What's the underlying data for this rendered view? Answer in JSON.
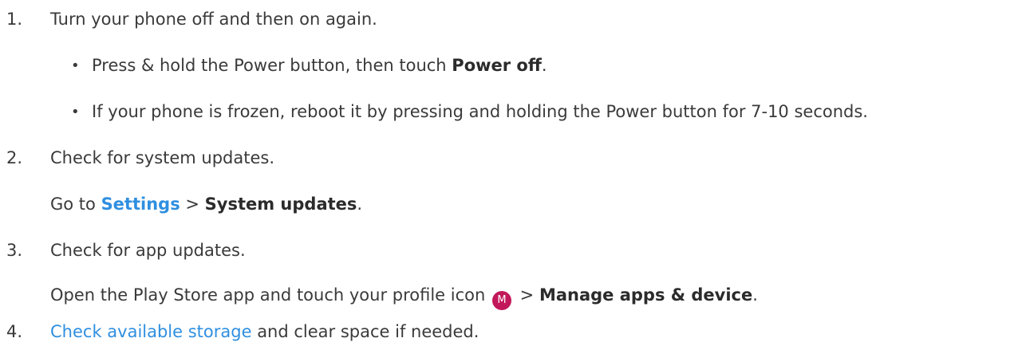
{
  "steps": [
    {
      "number": "1.",
      "text": "Turn your phone off and then on again.",
      "bullets": [
        {
          "prefix": "Press & hold the Power button, then touch ",
          "bold": "Power off",
          "suffix": "."
        },
        {
          "text": "If your phone is frozen, reboot it by pressing and holding the Power button for 7-10 seconds."
        }
      ]
    },
    {
      "number": "2.",
      "text": "Check for system updates.",
      "detail": {
        "prefix": "Go to ",
        "link": "Settings",
        "sep": " > ",
        "bold": "System updates",
        "suffix": "."
      }
    },
    {
      "number": "3.",
      "text": "Check for app updates.",
      "detail": {
        "prefix": "Open the Play Store app and touch your profile icon ",
        "avatar_letter": "M",
        "sep": " > ",
        "bold": "Manage apps & device",
        "suffix": "."
      }
    },
    {
      "number": "4.",
      "link": "Check available storage",
      "text": " and clear space if needed."
    }
  ],
  "colors": {
    "text": "#3a3a3a",
    "link": "#2f8fe0",
    "avatar": "#c2185b"
  },
  "icons": {
    "bullet": "bullet-dot",
    "avatar": "profile-avatar-icon"
  }
}
